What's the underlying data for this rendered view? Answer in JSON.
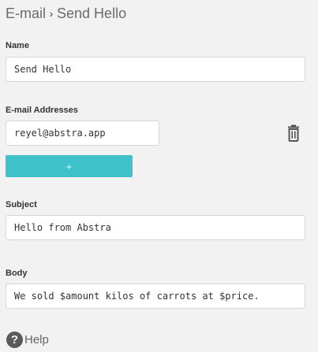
{
  "breadcrumb": {
    "parent": "E-mail",
    "separator": "›",
    "current": "Send Hello"
  },
  "fields": {
    "name": {
      "label": "Name",
      "value": "Send Hello"
    },
    "emails": {
      "label": "E-mail Addresses",
      "items": [
        "reyel@abstra.app"
      ],
      "add_label": "+",
      "delete_icon": "trash-icon"
    },
    "subject": {
      "label": "Subject",
      "value": "Hello from Abstra"
    },
    "body": {
      "label": "Body",
      "value": "We sold $amount kilos of carrots at $price."
    }
  },
  "help": {
    "icon": "?",
    "label": "Help"
  },
  "colors": {
    "accent": "#3fc2c9",
    "background": "#f2f2f2"
  }
}
